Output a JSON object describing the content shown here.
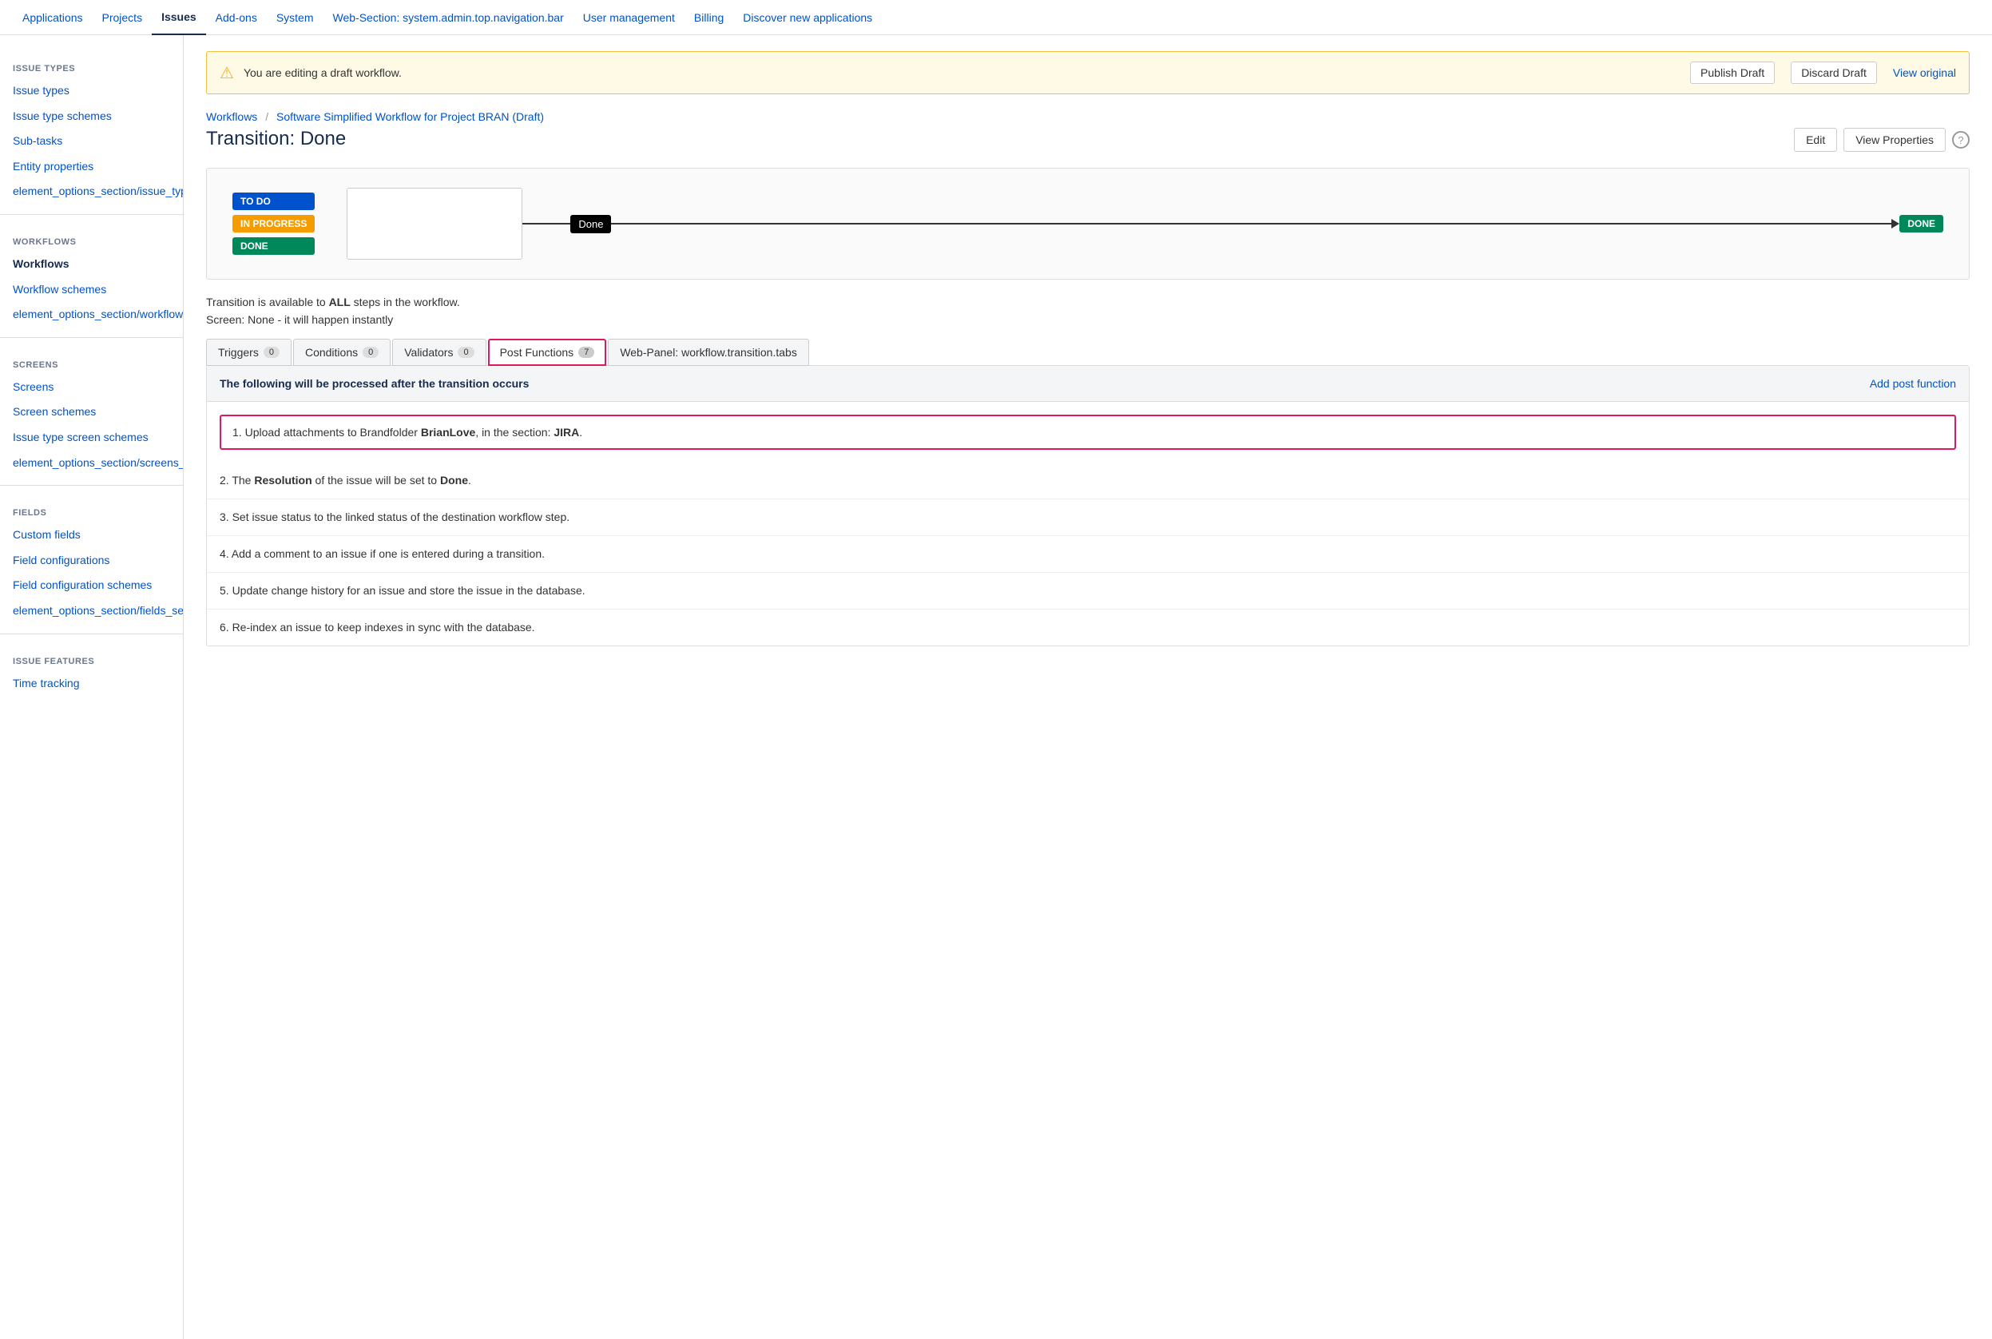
{
  "topnav": {
    "items": [
      {
        "label": "Applications",
        "active": false
      },
      {
        "label": "Projects",
        "active": false
      },
      {
        "label": "Issues",
        "active": true
      },
      {
        "label": "Add-ons",
        "active": false
      },
      {
        "label": "System",
        "active": false
      },
      {
        "label": "Web-Section: system.admin.top.navigation.bar",
        "active": false
      },
      {
        "label": "User management",
        "active": false
      },
      {
        "label": "Billing",
        "active": false
      },
      {
        "label": "Discover new applications",
        "active": false
      }
    ]
  },
  "sidebar": {
    "sections": [
      {
        "title": "ISSUE TYPES",
        "items": [
          {
            "label": "Issue types",
            "active": false
          },
          {
            "label": "Issue type schemes",
            "active": false
          },
          {
            "label": "Sub-tasks",
            "active": false
          },
          {
            "label": "Entity properties",
            "active": false
          },
          {
            "label": "element_options_section/issue_types_section",
            "active": false
          }
        ]
      },
      {
        "title": "WORKFLOWS",
        "items": [
          {
            "label": "Workflows",
            "active": true
          },
          {
            "label": "Workflow schemes",
            "active": false
          },
          {
            "label": "element_options_section/workflows_section",
            "active": false
          }
        ]
      },
      {
        "title": "SCREENS",
        "items": [
          {
            "label": "Screens",
            "active": false
          },
          {
            "label": "Screen schemes",
            "active": false
          },
          {
            "label": "Issue type screen schemes",
            "active": false
          },
          {
            "label": "element_options_section/screens_section",
            "active": false
          }
        ]
      },
      {
        "title": "FIELDS",
        "items": [
          {
            "label": "Custom fields",
            "active": false
          },
          {
            "label": "Field configurations",
            "active": false
          },
          {
            "label": "Field configuration schemes",
            "active": false
          },
          {
            "label": "element_options_section/fields_section",
            "active": false
          }
        ]
      },
      {
        "title": "ISSUE FEATURES",
        "items": [
          {
            "label": "Time tracking",
            "active": false
          }
        ]
      }
    ]
  },
  "banner": {
    "text": "You are editing a draft workflow.",
    "publish_btn": "Publish Draft",
    "discard_btn": "Discard Draft",
    "view_link": "View original"
  },
  "breadcrumb": {
    "parent": "Workflows",
    "current": "Software Simplified Workflow for Project BRAN (Draft)"
  },
  "page": {
    "title": "Transition: Done",
    "edit_btn": "Edit",
    "view_props_btn": "View Properties"
  },
  "diagram": {
    "states": [
      "TO DO",
      "IN PROGRESS",
      "DONE"
    ],
    "transition_label": "Done",
    "end_state": "DONE"
  },
  "transition": {
    "availability": "Transition is available to ALL steps in the workflow.",
    "screen": "Screen: None - it will happen instantly"
  },
  "tabs": [
    {
      "label": "Triggers",
      "count": "0",
      "active": false
    },
    {
      "label": "Conditions",
      "count": "0",
      "active": false
    },
    {
      "label": "Validators",
      "count": "0",
      "active": false
    },
    {
      "label": "Post Functions",
      "count": "7",
      "active": true
    },
    {
      "label": "Web-Panel: workflow.transition.tabs",
      "count": null,
      "active": false
    }
  ],
  "panel": {
    "header": "The following will be processed after the transition occurs",
    "add_link": "Add post function",
    "items": [
      {
        "num": 1,
        "text": "Upload attachments to Brandfolder BrianLove, in the section: JIRA.",
        "highlighted": true,
        "bold_parts": [
          "BrianLove",
          "JIRA"
        ]
      },
      {
        "num": 2,
        "text": "The Resolution of the issue will be set to Done.",
        "highlighted": false,
        "bold_parts": [
          "Resolution",
          "Done"
        ]
      },
      {
        "num": 3,
        "text": "Set issue status to the linked status of the destination workflow step.",
        "highlighted": false,
        "bold_parts": []
      },
      {
        "num": 4,
        "text": "Add a comment to an issue if one is entered during a transition.",
        "highlighted": false,
        "bold_parts": []
      },
      {
        "num": 5,
        "text": "Update change history for an issue and store the issue in the database.",
        "highlighted": false,
        "bold_parts": []
      },
      {
        "num": 6,
        "text": "Re-index an issue to keep indexes in sync with the database.",
        "highlighted": false,
        "bold_parts": []
      }
    ]
  }
}
